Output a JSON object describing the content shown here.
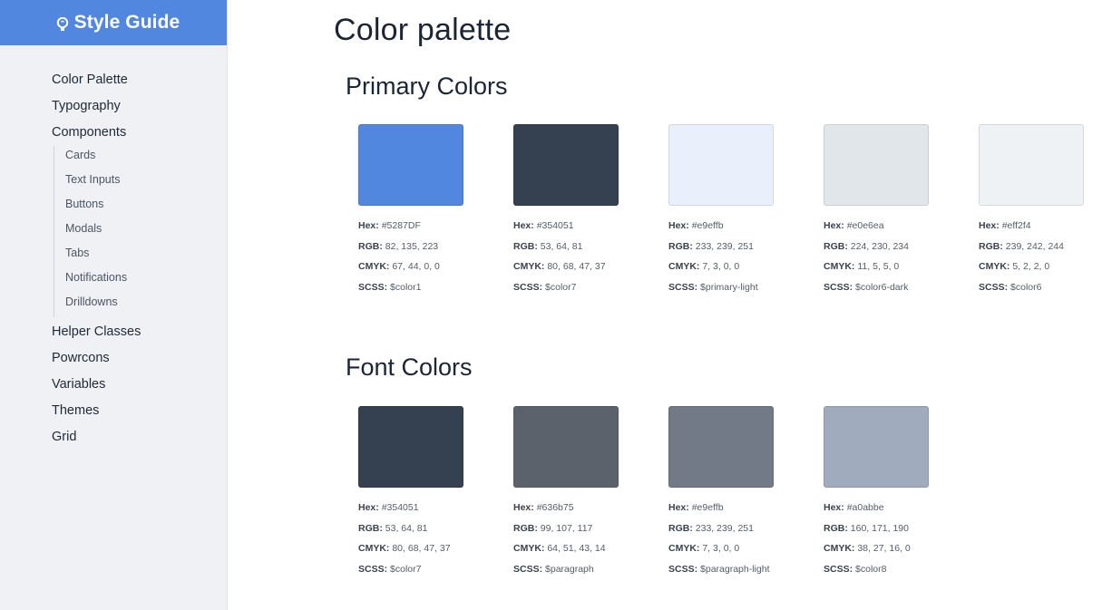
{
  "sidebar": {
    "brand": {
      "title": "Style Guide",
      "icon": "lightbulb-icon",
      "color": "#5287df"
    },
    "items": [
      {
        "label": "Color Palette"
      },
      {
        "label": "Typography"
      },
      {
        "label": "Components",
        "children": [
          {
            "label": "Cards"
          },
          {
            "label": "Text Inputs"
          },
          {
            "label": "Buttons"
          },
          {
            "label": "Modals"
          },
          {
            "label": "Tabs"
          },
          {
            "label": "Notifications"
          },
          {
            "label": "Drilldowns"
          }
        ]
      },
      {
        "label": "Helper Classes"
      },
      {
        "label": "Powrcons"
      },
      {
        "label": "Variables"
      },
      {
        "label": "Themes"
      },
      {
        "label": "Grid"
      }
    ]
  },
  "main": {
    "title": "Color palette",
    "labels": {
      "hex": "Hex:",
      "rgb": "RGB:",
      "cmyk": "CMYK:",
      "scss": "SCSS:"
    },
    "sections": [
      {
        "title": "Primary Colors",
        "swatches": [
          {
            "swatch_color": "#5287df",
            "hex": "#5287DF",
            "rgb": "82, 135, 223",
            "cmyk": "67, 44, 0, 0",
            "scss": "$color1"
          },
          {
            "swatch_color": "#354051",
            "hex": "#354051",
            "rgb": "53, 64, 81",
            "cmyk": "80, 68, 47, 37",
            "scss": "$color7"
          },
          {
            "swatch_color": "#e9effb",
            "hex": "#e9effb",
            "rgb": "233, 239, 251",
            "cmyk": "7, 3, 0, 0",
            "scss": "$primary-light"
          },
          {
            "swatch_color": "#e0e6ea",
            "hex": "#e0e6ea",
            "rgb": "224, 230, 234",
            "cmyk": "11, 5, 5, 0",
            "scss": "$color6-dark"
          },
          {
            "swatch_color": "#eff2f4",
            "hex": "#eff2f4",
            "rgb": "239, 242, 244",
            "cmyk": "5, 2, 2, 0",
            "scss": "$color6"
          }
        ]
      },
      {
        "title": "Font Colors",
        "swatches": [
          {
            "swatch_color": "#354051",
            "hex": "#354051",
            "rgb": "53, 64, 81",
            "cmyk": "80, 68, 47, 37",
            "scss": "$color7"
          },
          {
            "swatch_color": "#5c626b",
            "hex": "#636b75",
            "rgb": "99, 107, 117",
            "cmyk": "64, 51, 43, 14",
            "scss": "$paragraph"
          },
          {
            "swatch_color": "#717a86",
            "hex": "#e9effb",
            "rgb": "233, 239, 251",
            "cmyk": "7, 3, 0, 0",
            "scss": "$paragraph-light"
          },
          {
            "swatch_color": "#a0abbe",
            "hex": "#a0abbe",
            "rgb": "160, 171, 190",
            "cmyk": "38, 27, 16, 0",
            "scss": "$color8"
          }
        ]
      }
    ]
  }
}
